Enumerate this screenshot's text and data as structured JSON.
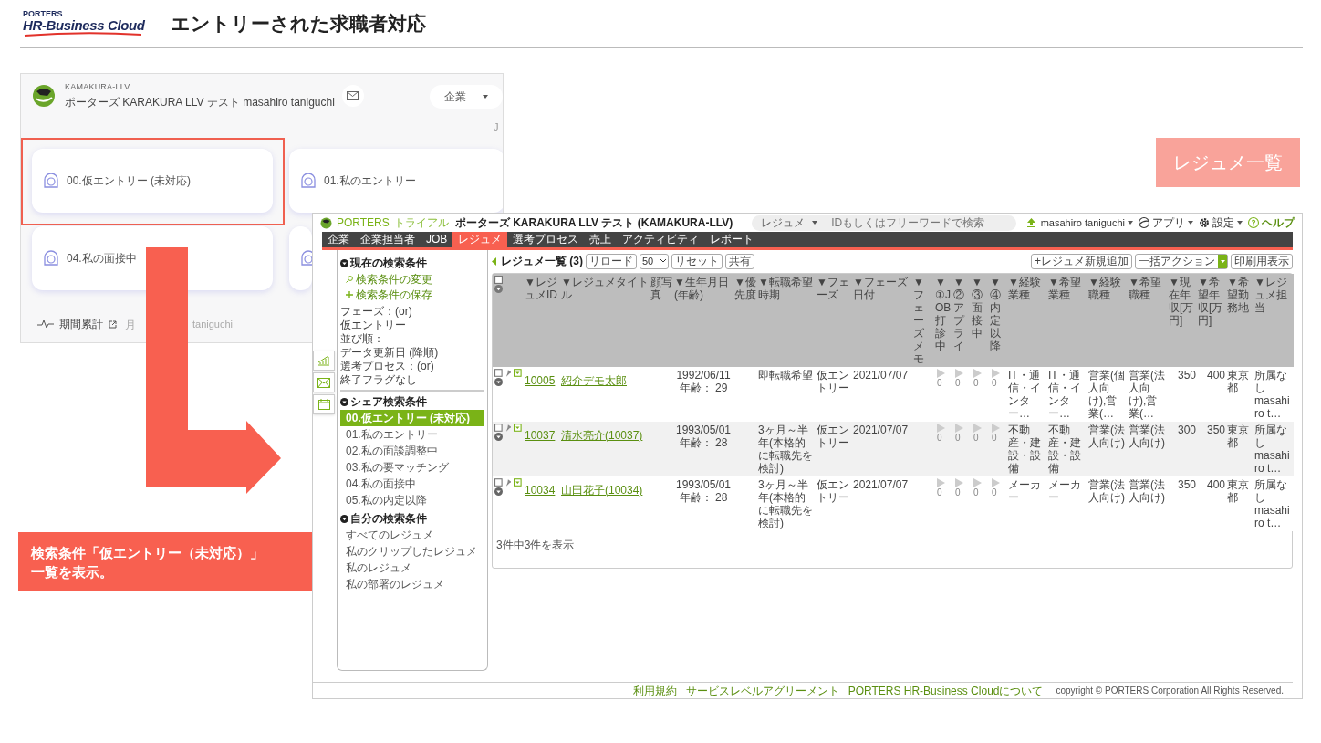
{
  "slide": {
    "brand_top": "PORTERS",
    "brand": "HR-Business Cloud",
    "title": "エントリーされた求職者対応",
    "badge": "レジュメ一覧",
    "note": [
      "検索条件「仮エントリー（未対応）」",
      "一覧を表示。"
    ]
  },
  "dashboard": {
    "org": "KAMAKURA-LLV",
    "user": "ポーターズ KARAKURA LLV テスト masahiro taniguchi",
    "select": "企業",
    "cut_label": "J",
    "cards": [
      {
        "label": "00.仮エントリー (未対応)",
        "selected": true
      },
      {
        "label": "01.私のエントリー",
        "selected": false
      },
      {
        "label": "04.私の面接中",
        "selected": false
      },
      {
        "selected": false
      }
    ],
    "footer": {
      "label": "期間累計",
      "note_start": "月",
      "note_end": "taniguchi"
    }
  },
  "app": {
    "brand": "PORTERS",
    "plan": "トライアル",
    "company": "ポーターズ KARAKURA LLV テスト (KAMAKURA-LLV)",
    "search_scope": "レジュメ",
    "search_placeholder": "IDもしくはフリーワードで検索",
    "user": "masahiro taniguchi",
    "menus": [
      "アプリ",
      "設定",
      "ヘルプ"
    ],
    "nav": [
      {
        "label": "企業",
        "selected": false
      },
      {
        "label": "企業担当者",
        "selected": false
      },
      {
        "label": "JOB",
        "selected": false
      },
      {
        "label": "レジュメ",
        "selected": true
      },
      {
        "label": "選考プロセス",
        "selected": false
      },
      {
        "label": "売上",
        "selected": false
      },
      {
        "label": "アクティビティ",
        "selected": false
      },
      {
        "label": "レポート",
        "selected": false
      }
    ],
    "sidebar": {
      "current_title": "現在の検索条件",
      "actions": [
        {
          "kind": "search",
          "label": "検索条件の変更"
        },
        {
          "kind": "add",
          "label": "検索条件の保存"
        }
      ],
      "conditions": [
        "フェーズ：(or)",
        "仮エントリー",
        "並び順：",
        "データ更新日 (降順)",
        "選考プロセス：(or)",
        "終了フラグなし"
      ],
      "groups": [
        {
          "title": "シェア検索条件",
          "items": [
            {
              "label": "00.仮エントリー (未対応)",
              "selected": true
            },
            {
              "label": "01.私のエントリー",
              "selected": false
            },
            {
              "label": "02.私の面談調整中",
              "selected": false
            },
            {
              "label": "03.私の要マッチング",
              "selected": false
            },
            {
              "label": "04.私の面接中",
              "selected": false
            },
            {
              "label": "05.私の内定以降",
              "selected": false
            }
          ]
        },
        {
          "title": "自分の検索条件",
          "items": [
            {
              "label": "すべてのレジュメ",
              "selected": false
            },
            {
              "label": "私のクリップしたレジュメ",
              "selected": false
            },
            {
              "label": "私のレジュメ",
              "selected": false
            },
            {
              "label": "私の部署のレジュメ",
              "selected": false
            }
          ]
        }
      ]
    },
    "list": {
      "title": "レジュメ一覧 (3)",
      "reload": "リロード",
      "page_size": "50",
      "reset": "リセット",
      "share": "共有",
      "add": "+レジュメ新規追加",
      "bulk": "一括アクション",
      "print": "印刷用表示",
      "all_checked": false,
      "columns": [
        "▼レジュメID",
        "▼レジュメタイトル",
        "顔写真",
        "▼生年月日(年齢)",
        "▼優先度",
        "▼転職希望時期",
        "▼フェーズ",
        "▼フェーズ日付",
        "▼フェーズメモ",
        "▼①JOB打診中",
        "▼②アプライ",
        "▼③面接中",
        "▼④内定以降",
        "▼経験業種",
        "▼希望業種",
        "▼経験職種",
        "▼希望職種",
        "▼現在年収[万円]",
        "▼希望年収[万円]",
        "▼希望勤務地",
        "▼レジュメ担当"
      ],
      "rows": [
        {
          "checked": false,
          "id": "10005",
          "title": "紹介デモ太郎",
          "birth": "1992/06/11",
          "age": "年齢： 29",
          "timing": "即転職希望",
          "phase": "仮エントリー",
          "phase_date": "2021/07/07",
          "stage_counts": [
            "0",
            "0",
            "0",
            "0"
          ],
          "exp_industry": "IT・通信・インター…",
          "want_industry": "IT・通信・インター…",
          "exp_job": "営業(個人向け),営業(…",
          "want_job": "営業(法人向け),営業(…",
          "salary_now": "350",
          "salary_want": "400",
          "location": "東京都",
          "owner": "所属なし masahiro t…"
        },
        {
          "checked": false,
          "id": "10037",
          "title": "清水亮介(10037)",
          "birth": "1993/05/01",
          "age": "年齢： 28",
          "timing": "3ヶ月～半年(本格的に転職先を検討)",
          "phase": "仮エントリー",
          "phase_date": "2021/07/07",
          "stage_counts": [
            "0",
            "0",
            "0",
            "0"
          ],
          "exp_industry": "不動産・建設・設備",
          "want_industry": "不動産・建設・設備",
          "exp_job": "営業(法人向け)",
          "want_job": "営業(法人向け)",
          "salary_now": "300",
          "salary_want": "350",
          "location": "東京都",
          "owner": "所属なし masahiro t…"
        },
        {
          "checked": false,
          "id": "10034",
          "title": "山田花子(10034)",
          "birth": "1993/05/01",
          "age": "年齢： 28",
          "timing": "3ヶ月～半年(本格的に転職先を検討)",
          "phase": "仮エントリー",
          "phase_date": "2021/07/07",
          "stage_counts": [
            "0",
            "0",
            "0",
            "0"
          ],
          "exp_industry": "メーカー",
          "want_industry": "メーカー",
          "exp_job": "営業(法人向け)",
          "want_job": "営業(法人向け)",
          "salary_now": "350",
          "salary_want": "400",
          "location": "東京都",
          "owner": "所属なし masahiro t…"
        }
      ],
      "count": "3件中3件を表示"
    },
    "footer": {
      "links": [
        "利用規約",
        "サービスレベルアグリーメント",
        "PORTERS HR-Business Cloudについて"
      ],
      "copyright": "copyright © PORTERS Corporation All Rights Reserved."
    }
  }
}
